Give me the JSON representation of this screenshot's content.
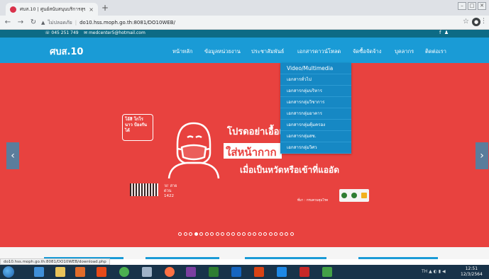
{
  "browser": {
    "tab_title": "ศบส.10 | ศูนย์สนับสนุนบริการสุขภา",
    "tab_close": "×",
    "new_tab": "+",
    "security_label": "ไม่ปลอดภัย",
    "url": "do10.hss.moph.go.th:8081/DO10WEB/",
    "status_url": "do10.hss.moph.go.th:8081/DO10WEB/download.php"
  },
  "site": {
    "phone": "045 251 749",
    "email": "medcenter5@hotmail.com",
    "logo": "ศบส.10",
    "nav": [
      "หน้าหลัก",
      "ข้อมูลหน่วยงาน",
      "ประชาสัมพันธ์",
      "เอกสารดาวน์โหลด",
      "จัดซื้อจัดจ้าง",
      "บุคลากร",
      "ติดต่อเรา"
    ],
    "dropdown": [
      "Video/Multimedia",
      "เอกสารทั่วไป",
      "เอกสารกลุ่มบริหาร",
      "เอกสารกลุ่มวิชาการ",
      "เอกสารกลุ่มอาคาร",
      "เอกสารกลุ่มคุ้มครอง",
      "เอกสารกลุ่มสช.",
      "เอกสารกลุ่มวิศว"
    ]
  },
  "banner": {
    "badge": "โอ้สิ โกโรนาว ป้องกันได้",
    "line1": "โปรดอย่าเอื้อเฟ้",
    "line2": "ใส่หน้ากาก",
    "line3": "เมื่อเป็นหวัดหรือเข้าที่แออัด",
    "hotline": "สายด่วน 1422",
    "credit": "ที่มา : กรมควบคุมโรค",
    "prev_arrow": "‹",
    "next_arrow": "›",
    "slide_count": 22,
    "active_slide": 3
  },
  "taskbar": {
    "tray": "TH",
    "time": "12:51",
    "date": "12/3/2564"
  }
}
